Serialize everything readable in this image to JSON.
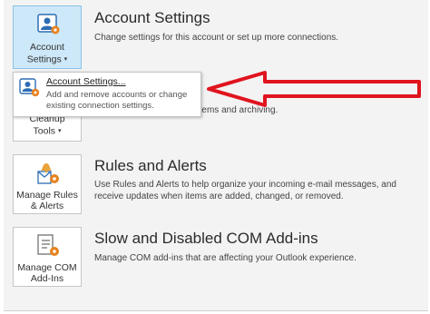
{
  "account_settings": {
    "tile_label_line1": "Account",
    "tile_label_line2": "Settings",
    "caret": "▾",
    "heading": "Account Settings",
    "description": "Change settings for this account or set up more connections."
  },
  "dropdown": {
    "item_title": "Account Settings...",
    "item_description": "Add and remove accounts or change existing connection settings."
  },
  "cleanup": {
    "tile_label_line1": "Cleanup",
    "tile_label_line2": "Tools",
    "caret": "▾",
    "description_visible": "box by emptying Deleted Items and archiving."
  },
  "rules": {
    "tile_label_line1": "Manage Rules",
    "tile_label_line2": "& Alerts",
    "heading": "Rules and Alerts",
    "description": "Use Rules and Alerts to help organize your incoming e-mail messages, and receive updates when items are added, changed, or removed."
  },
  "com_addins": {
    "tile_label_line1": "Manage COM",
    "tile_label_line2": "Add-Ins",
    "heading": "Slow and Disabled COM Add-ins",
    "description": "Manage COM add-ins that are affecting your Outlook experience."
  },
  "colors": {
    "selected_tile": "#cde8f8",
    "accent_blue": "#2e6db4",
    "gear_orange": "#e8821e",
    "arrow_red": "#e0141e"
  },
  "icons": [
    "account-user-icon",
    "gear-icon",
    "cleanup-tools-icon",
    "rules-alerts-icon",
    "com-addins-icon",
    "chevron-down-icon"
  ]
}
